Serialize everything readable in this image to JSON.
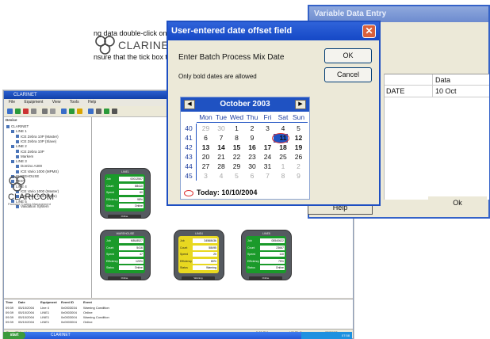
{
  "main_window": {
    "title": "CLARINET",
    "menu": [
      "File",
      "Equipment",
      "View",
      "Tools",
      "Help"
    ],
    "tree_header": "Device",
    "tree": [
      "CLARINET",
      "LINE 1",
      "ICE Zebra 10P (Master)",
      "ICE Zebra 10P (Slave)",
      "LINE 2",
      "ICE Zebra 10P",
      "Markem",
      "LINE 3",
      "Domino A300",
      "ICE Vario 1000 (MPMS)",
      "WAREHOUSE",
      "TEST",
      "LINE 4",
      "ICE Vario 1000 (Master)",
      "ICE Vario 1000 (Slave)",
      "LINE 5",
      "Validation System"
    ],
    "devices": [
      {
        "title": "LINE1",
        "color": "#1a9a2a",
        "rows": [
          [
            "Job",
            "00012507"
          ],
          [
            "Count",
            "88410"
          ],
          [
            "Speed",
            "60"
          ],
          [
            "Efficiency",
            "98%"
          ],
          [
            "Status",
            "Online"
          ]
        ],
        "status": "Online"
      },
      {
        "title": "WAREHOUSE",
        "color": "#1a9a2a",
        "rows": [
          [
            "Job",
            "M8U8527"
          ],
          [
            "Count",
            "5416"
          ],
          [
            "Speed",
            "47"
          ],
          [
            "Efficiency",
            "120%"
          ],
          [
            "Status",
            "Online"
          ]
        ],
        "status": "Online"
      },
      {
        "title": "LINE4",
        "color": "#e8d820",
        "rows": [
          [
            "Job",
            "34568436"
          ],
          [
            "Count",
            "58495"
          ],
          [
            "Speed",
            "20"
          ],
          [
            "Efficiency",
            "80%"
          ],
          [
            "Status",
            "Warning"
          ]
        ],
        "status": "Warning"
      },
      {
        "title": "LINE5",
        "color": "#1a9a2a",
        "rows": [
          [
            "Job",
            "08540622"
          ],
          [
            "Count",
            "23667"
          ],
          [
            "Speed",
            "110"
          ],
          [
            "Efficiency",
            "75%"
          ],
          [
            "Status",
            "Online"
          ]
        ],
        "status": "Online"
      }
    ],
    "logo_text": "CLARINET",
    "logo_bottom_text": "CLARICOM",
    "logo_bottom_sub": "Package Coding Management",
    "log_columns": [
      "Time",
      "Date",
      "Equipment",
      "Event ID",
      "Event"
    ],
    "log_rows": [
      [
        "09:39",
        "05/10/2004",
        "Line 4",
        "0x0003034",
        "Warning Condition"
      ],
      [
        "09:39",
        "05/10/2004",
        "LINE1",
        "0x0003004",
        "Online"
      ],
      [
        "09:39",
        "05/10/2004",
        "LINE1",
        "0x0003004",
        "Warning Condition"
      ],
      [
        "09:39",
        "05/10/2004",
        "LINE1",
        "0x0003004",
        "Online"
      ]
    ],
    "status_left": "Press F1 for Help",
    "status_mid": "5:26 PM",
    "status_right": "LEVEL 5",
    "status_date": "07/08/03"
  },
  "variable_data_entry": {
    "title": "Variable Data Entry",
    "instruction_1": "ng data double-click on the field tha",
    "instruction_2": "nsure that the tick box to the left ha",
    "column_data": "Data",
    "row_name": "DATE",
    "row_value": "10 Oct",
    "help_label": "Help",
    "ok_label": "Ok"
  },
  "dialog": {
    "title": "User-entered date offset field",
    "close_glyph": "✕",
    "prompt": "Enter Batch Process Mix Date",
    "note": "Only bold dates are allowed",
    "ok_label": "OK",
    "cancel_label": "Cancel"
  },
  "calendar": {
    "month_label": "October 2003",
    "prev_glyph": "◀",
    "next_glyph": "▶",
    "weekdays": [
      "Mon",
      "Tue",
      "Wed",
      "Thu",
      "Fri",
      "Sat",
      "Sun"
    ],
    "weeks": [
      {
        "wk": "40",
        "days": [
          [
            "29",
            "other"
          ],
          [
            "30",
            "other"
          ],
          [
            "1",
            ""
          ],
          [
            "2",
            ""
          ],
          [
            "3",
            ""
          ],
          [
            "4",
            ""
          ],
          [
            "5",
            ""
          ]
        ]
      },
      {
        "wk": "41",
        "days": [
          [
            "6",
            ""
          ],
          [
            "7",
            ""
          ],
          [
            "8",
            ""
          ],
          [
            "9",
            ""
          ],
          [
            "10",
            "sel"
          ],
          [
            "11",
            "bold"
          ],
          [
            "12",
            "bold"
          ]
        ]
      },
      {
        "wk": "42",
        "days": [
          [
            "13",
            "bold"
          ],
          [
            "14",
            "bold"
          ],
          [
            "15",
            "bold"
          ],
          [
            "16",
            "bold"
          ],
          [
            "17",
            "bold"
          ],
          [
            "18",
            "bold"
          ],
          [
            "19",
            "bold"
          ]
        ]
      },
      {
        "wk": "43",
        "days": [
          [
            "20",
            ""
          ],
          [
            "21",
            ""
          ],
          [
            "22",
            ""
          ],
          [
            "23",
            ""
          ],
          [
            "24",
            ""
          ],
          [
            "25",
            ""
          ],
          [
            "26",
            ""
          ]
        ]
      },
      {
        "wk": "44",
        "days": [
          [
            "27",
            ""
          ],
          [
            "28",
            ""
          ],
          [
            "29",
            ""
          ],
          [
            "30",
            ""
          ],
          [
            "31",
            ""
          ],
          [
            "1",
            "other"
          ],
          [
            "2",
            "other"
          ]
        ]
      },
      {
        "wk": "45",
        "days": [
          [
            "3",
            "other"
          ],
          [
            "4",
            "other"
          ],
          [
            "5",
            "other"
          ],
          [
            "6",
            "other"
          ],
          [
            "7",
            "other"
          ],
          [
            "8",
            "other"
          ],
          [
            "9",
            "other"
          ]
        ]
      }
    ],
    "today_label": "Today: 10/10/2004"
  },
  "taskbar": {
    "start_label": "start",
    "task_label": "CLARINET",
    "clock": "07:58"
  },
  "colors": {
    "dialog_title": "#1548c6",
    "calendar_header": "#1f52c2",
    "today_ring": "#d33333",
    "device_ok": "#1a9a2a",
    "device_warning": "#e8d820"
  }
}
